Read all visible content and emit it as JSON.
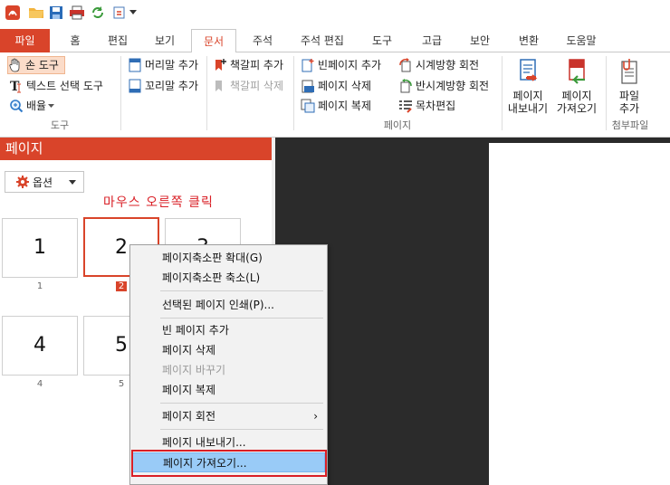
{
  "quick_access": {
    "icons": [
      "app-logo-icon",
      "open-folder-icon",
      "save-icon",
      "print-icon",
      "refresh-icon",
      "insert-page-icon",
      "dropdown-icon"
    ]
  },
  "tabs": [
    "파일",
    "홈",
    "편집",
    "보기",
    "문서",
    "주석",
    "주석 편집",
    "도구",
    "고급",
    "보안",
    "변환",
    "도움말"
  ],
  "active_tab": "문서",
  "ribbon": {
    "tool_group": {
      "hand_tool": "손 도구",
      "text_select": "텍스트 선택 도구",
      "zoom": "배율",
      "label": "도구"
    },
    "header_group": {
      "header_add": "머리말 추가",
      "footer_add": "꼬리말 추가"
    },
    "bookmark_group": {
      "bookmark_add": "책갈피 추가",
      "bookmark_delete": "책갈피 삭제"
    },
    "page_group": {
      "blank_page_add": "빈페이지 추가",
      "page_delete": "페이지 삭제",
      "page_copy": "페이지 복제",
      "rotate_cw": "시계방향 회전",
      "rotate_ccw": "반시계방향 회전",
      "toc_edit": "목차편집",
      "label": "페이지"
    },
    "export_btn": [
      "페이지",
      "내보내기"
    ],
    "import_btn": [
      "페이지",
      "가져오기"
    ],
    "attach_btn": [
      "파일",
      "추가"
    ],
    "attach_label": "첨부파일"
  },
  "panel": {
    "title": "페이지",
    "options": "옵션",
    "annotation": "마우스 오른쪽 클릭",
    "thumbnails": [
      "1",
      "2",
      "3",
      "4",
      "5"
    ],
    "selected": "2"
  },
  "context_menu": {
    "items": [
      {
        "label": "페이지축소판 확대(G)",
        "disabled": false
      },
      {
        "label": "페이지축소판 축소(L)",
        "disabled": false
      },
      {
        "label": "선택된 페이지 인쇄(P)...",
        "disabled": false
      },
      {
        "label": "빈 페이지 추가",
        "disabled": false
      },
      {
        "label": "페이지 삭제",
        "disabled": false
      },
      {
        "label": "페이지 바꾸기",
        "disabled": true
      },
      {
        "label": "페이지 복제",
        "disabled": false
      },
      {
        "label": "페이지 회전",
        "disabled": false
      },
      {
        "label": "페이지 내보내기...",
        "disabled": false
      },
      {
        "label": "페이지 가져오기...",
        "disabled": false
      }
    ],
    "submenu_arrow": "›"
  },
  "colors": {
    "accent": "#d9442a",
    "highlight": "#99cbf7",
    "annotation": "#d91f26"
  }
}
